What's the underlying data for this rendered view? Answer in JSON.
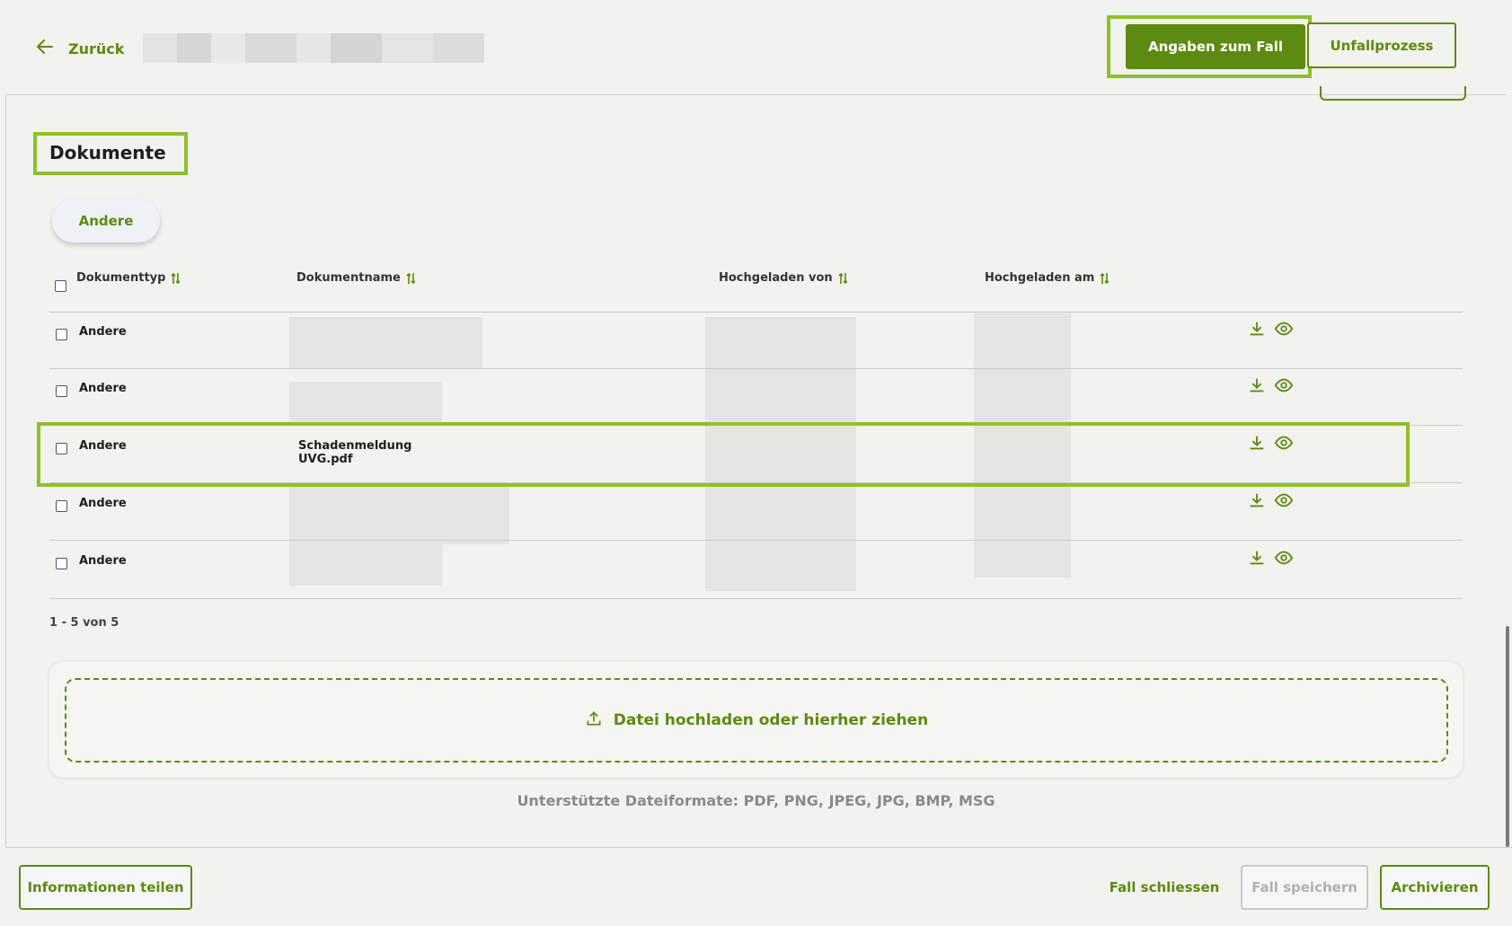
{
  "header": {
    "back_label": "Zurück",
    "tabs": [
      {
        "label": "Angaben zum Fall",
        "active": true
      },
      {
        "label": "Unfallprozess",
        "active": false
      }
    ]
  },
  "section": {
    "title": "Dokumente",
    "filter_chip": "Andere"
  },
  "table": {
    "columns": [
      "Dokumenttyp",
      "Dokumentname",
      "Hochgeladen von",
      "Hochgeladen am"
    ],
    "rows": [
      {
        "type": "Andere",
        "name": ""
      },
      {
        "type": "Andere",
        "name": ""
      },
      {
        "type": "Andere",
        "name": "Schadenmeldung UVG.pdf"
      },
      {
        "type": "Andere",
        "name": ""
      },
      {
        "type": "Andere",
        "name": ""
      }
    ],
    "pagination": "1 - 5 von 5"
  },
  "upload": {
    "label": "Datei hochladen oder hierher ziehen",
    "formats": "Unterstützte Dateiformate: PDF, PNG, JPEG, JPG, BMP, MSG"
  },
  "footer": {
    "share": "Informationen teilen",
    "close": "Fall schliessen",
    "save": "Fall speichern",
    "archive": "Archivieren"
  },
  "colors": {
    "accent": "#5d8a10",
    "highlight": "#8ec02c",
    "background": "#f2f2ee"
  },
  "icons": [
    "arrow-left-icon",
    "sort-icon",
    "download-icon",
    "eye-icon",
    "upload-icon"
  ]
}
